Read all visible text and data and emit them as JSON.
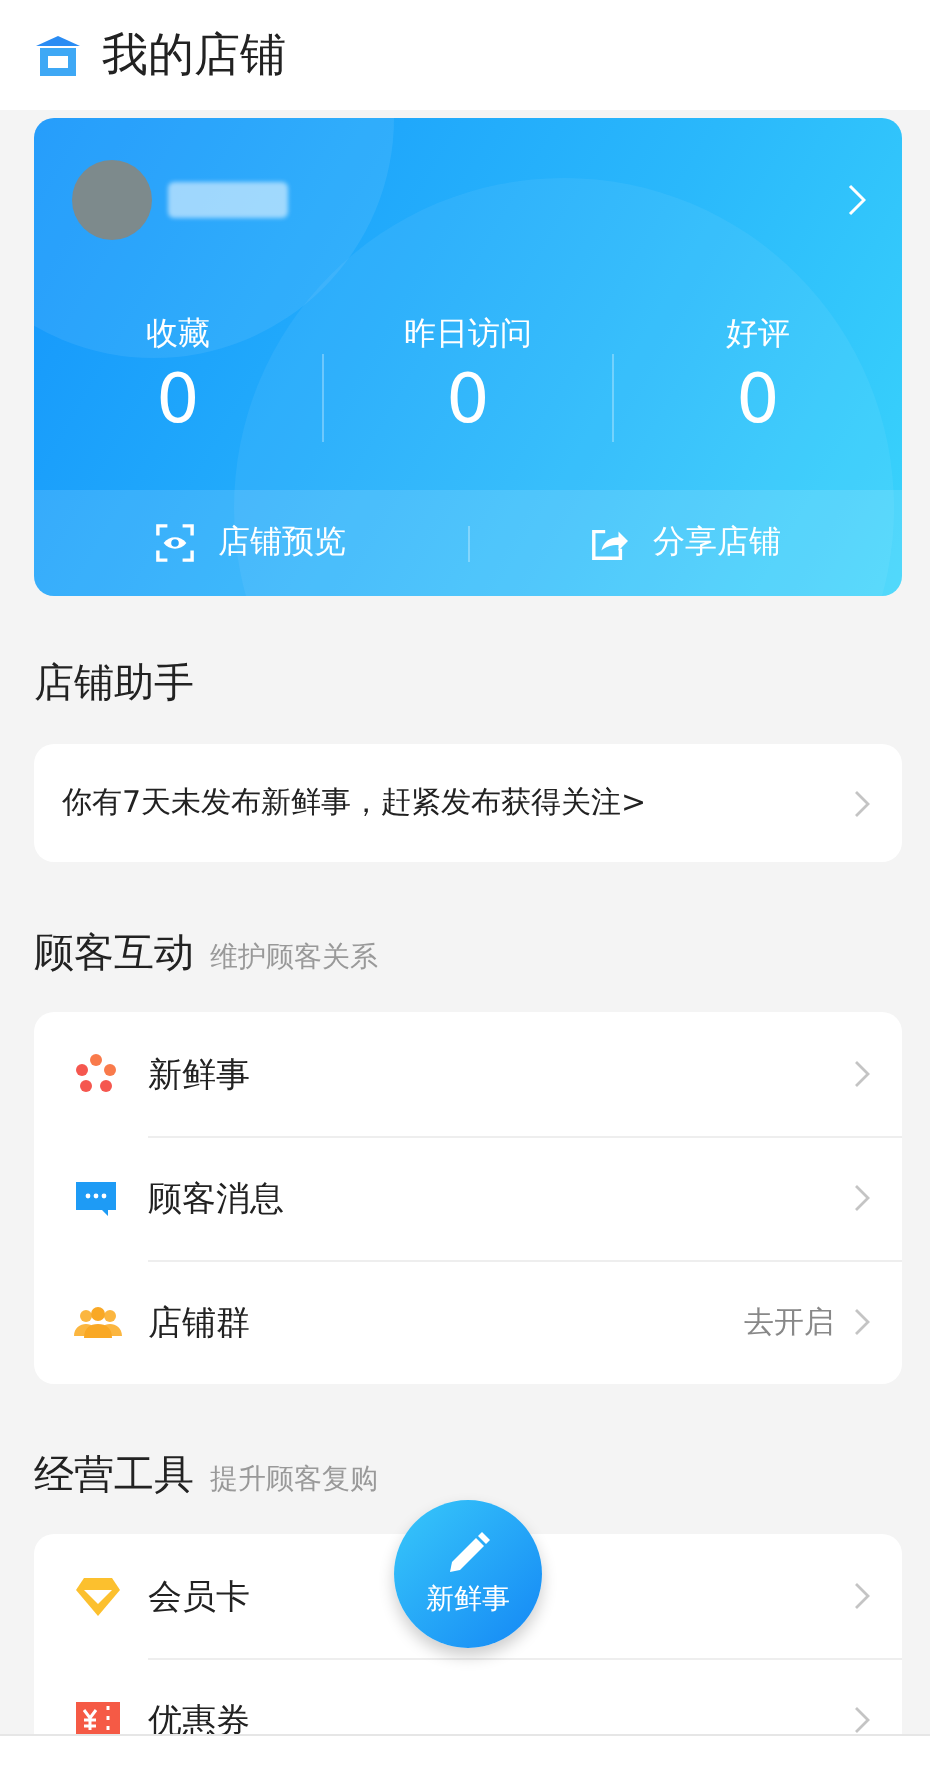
{
  "header": {
    "title": "我的店铺"
  },
  "store_card": {
    "stats": [
      {
        "label": "收藏",
        "value": "0"
      },
      {
        "label": "昨日访问",
        "value": "0"
      },
      {
        "label": "好评",
        "value": "0"
      }
    ],
    "actions": [
      {
        "kind": "preview",
        "label": "店铺预览"
      },
      {
        "kind": "share",
        "label": "分享店铺"
      }
    ]
  },
  "assistant": {
    "title": "店铺助手",
    "notice": "你有7天未发布新鲜事，赶紧发布获得关注>"
  },
  "sections": [
    {
      "title": "顾客互动",
      "subtitle": "维护顾客关系",
      "items": [
        {
          "kind": "news",
          "label": "新鲜事"
        },
        {
          "kind": "message",
          "label": "顾客消息"
        },
        {
          "kind": "group",
          "label": "店铺群",
          "action": "去开启"
        }
      ]
    },
    {
      "title": "经营工具",
      "subtitle": "提升顾客复购",
      "items": [
        {
          "kind": "vip",
          "label": "会员卡"
        },
        {
          "kind": "coupon",
          "label": "优惠券"
        }
      ]
    }
  ],
  "fab": {
    "label": "新鲜事"
  }
}
